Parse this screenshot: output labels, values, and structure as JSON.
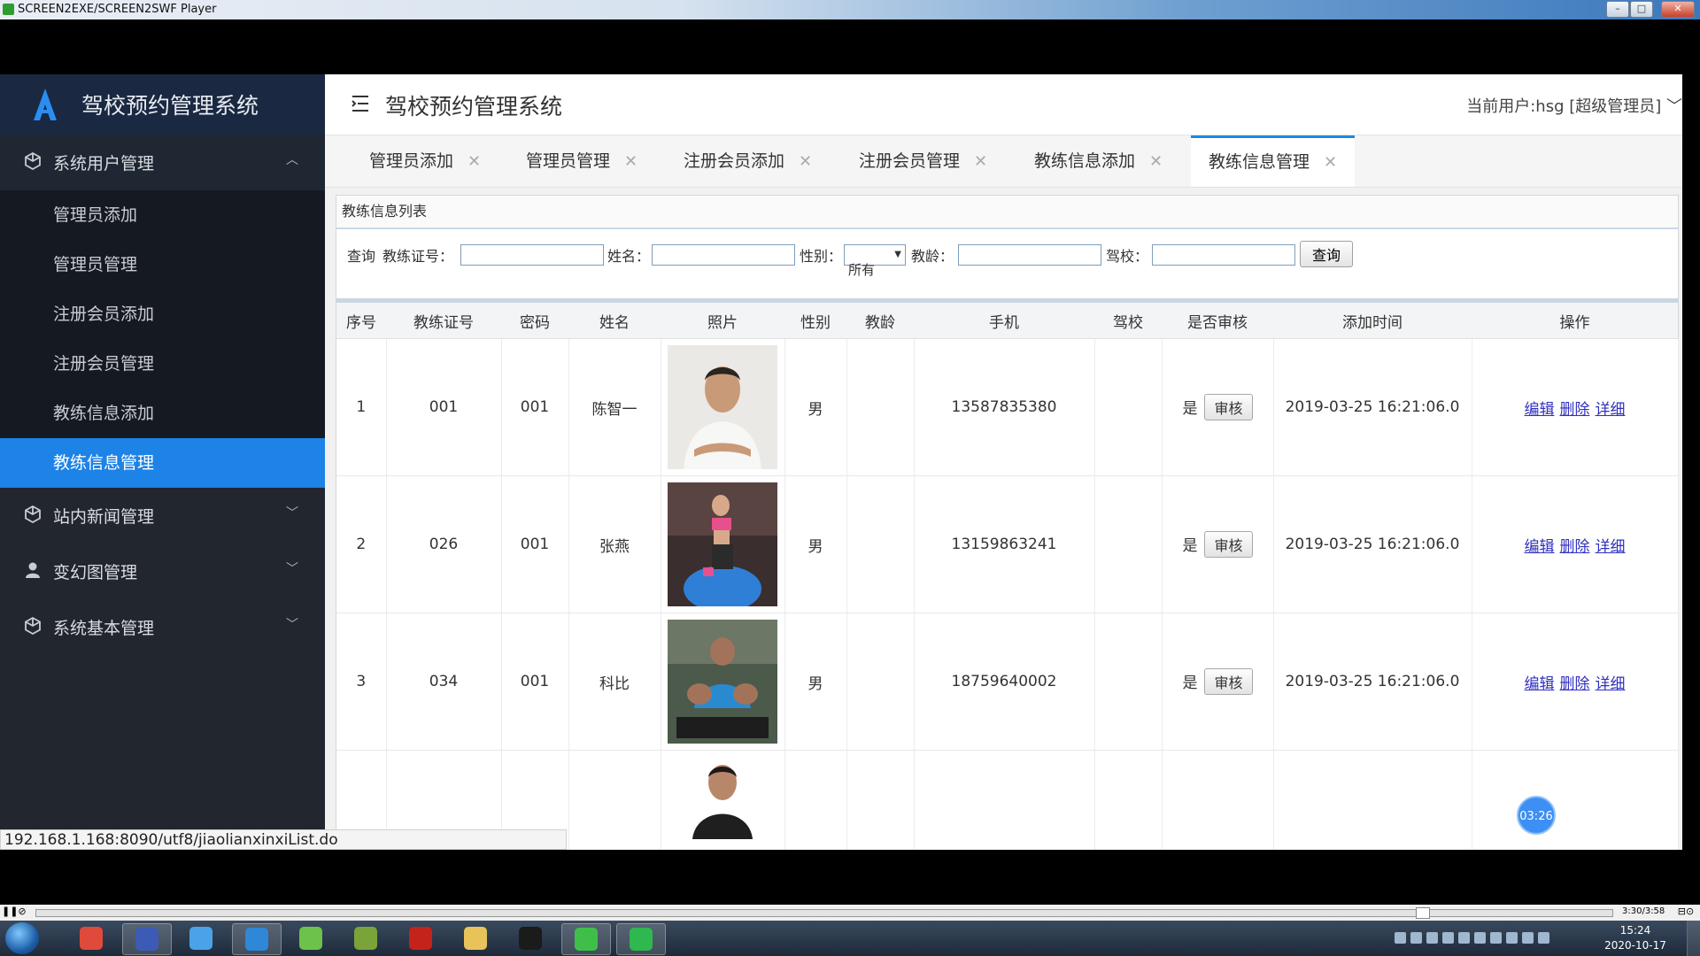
{
  "player": {
    "title": "SCREEN2EXE/SCREEN2SWF Player",
    "minimize_glyph": "–",
    "maximize_glyph": "□",
    "close_glyph": "✕",
    "time": "3:30/3:58",
    "pause_glyph": "❚❚",
    "stop_glyph": "⊘",
    "right_controls": "⊟⊙"
  },
  "sidebar": {
    "logo_text": "驾校预约管理系统",
    "groups": [
      {
        "label": "系统用户管理",
        "chevron": "︿",
        "icon": "cube-icon"
      },
      {
        "label": "站内新闻管理",
        "chevron": "﹀",
        "icon": "cube-icon"
      },
      {
        "label": "变幻图管理",
        "chevron": "﹀",
        "icon": "user-icon"
      },
      {
        "label": "系统基本管理",
        "chevron": "﹀",
        "icon": "cube-icon"
      }
    ],
    "items": [
      {
        "label": "管理员添加"
      },
      {
        "label": "管理员管理"
      },
      {
        "label": "注册会员添加"
      },
      {
        "label": "注册会员管理"
      },
      {
        "label": "教练信息添加"
      },
      {
        "label": "教练信息管理"
      }
    ],
    "colors": {
      "active": "#1d83e6",
      "background": "#22262f"
    }
  },
  "topbar": {
    "title": "驾校预约管理系统",
    "user": "当前用户:hsg [超级管理员]",
    "user_chevron": "﹀"
  },
  "tabs": [
    {
      "label": "管理员添加",
      "close": "✕"
    },
    {
      "label": "管理员管理",
      "close": "✕"
    },
    {
      "label": "注册会员添加",
      "close": "✕"
    },
    {
      "label": "注册会员管理",
      "close": "✕"
    },
    {
      "label": "教练信息添加",
      "close": "✕"
    },
    {
      "label": "教练信息管理",
      "close": "✕"
    }
  ],
  "panel": {
    "title": "教练信息列表",
    "search": {
      "query_label": "查询",
      "license_label": "教练证号：",
      "name_label": "姓名：",
      "gender_label": "性别：",
      "gender_value": "所有",
      "gender_arrow": "▼",
      "age_label": "教龄：",
      "school_label": "驾校：",
      "button": "查询"
    }
  },
  "table": {
    "headers": [
      "序号",
      "教练证号",
      "密码",
      "姓名",
      "照片",
      "性别",
      "教龄",
      "手机",
      "驾校",
      "是否审核",
      "添加时间",
      "操作"
    ],
    "audit_button": "审核",
    "op_labels": [
      "编辑",
      "删除",
      "详细"
    ],
    "rows": [
      {
        "no": "1",
        "license": "001",
        "password": "001",
        "name": "陈智一",
        "gender": "男",
        "age": "",
        "phone": "13587835380",
        "school": "",
        "audited": "是",
        "time": "2019-03-25 16:21:06.0"
      },
      {
        "no": "2",
        "license": "026",
        "password": "001",
        "name": "张燕",
        "gender": "男",
        "age": "",
        "phone": "13159863241",
        "school": "",
        "audited": "是",
        "time": "2019-03-25 16:21:06.0"
      },
      {
        "no": "3",
        "license": "034",
        "password": "001",
        "name": "科比",
        "gender": "男",
        "age": "",
        "phone": "18759640002",
        "school": "",
        "audited": "是",
        "time": "2019-03-25 16:21:06.0"
      },
      {
        "no": "",
        "license": "",
        "password": "",
        "name": "",
        "gender": "",
        "age": "",
        "phone": "",
        "school": "",
        "audited": "",
        "time": ""
      }
    ]
  },
  "timer_badge": "03:26",
  "status_url": "192.168.1.168:8090/utf8/jiaolianxinxiList.do",
  "taskbar": {
    "clock_time": "15:24",
    "clock_date": "2020-10-17",
    "apps": [
      {
        "icon": "chrome-icon",
        "color": "#e04a3a"
      },
      {
        "icon": "editor-icon",
        "color": "#3b5bb5"
      },
      {
        "icon": "baidu-icon",
        "color": "#4aa3e8"
      },
      {
        "icon": "browser-q-icon",
        "color": "#2f87d8"
      },
      {
        "icon": "leaf-icon",
        "color": "#6cc24a"
      },
      {
        "icon": "notepad-icon",
        "color": "#7aa33a"
      },
      {
        "icon": "flash-icon",
        "color": "#c4231a"
      },
      {
        "icon": "folder-icon",
        "color": "#e7c35a"
      },
      {
        "icon": "qq-icon",
        "color": "#1b1b1b"
      },
      {
        "icon": "wechat-icon",
        "color": "#3fbf4a"
      },
      {
        "icon": "player-icon",
        "color": "#2fb84f"
      }
    ]
  }
}
